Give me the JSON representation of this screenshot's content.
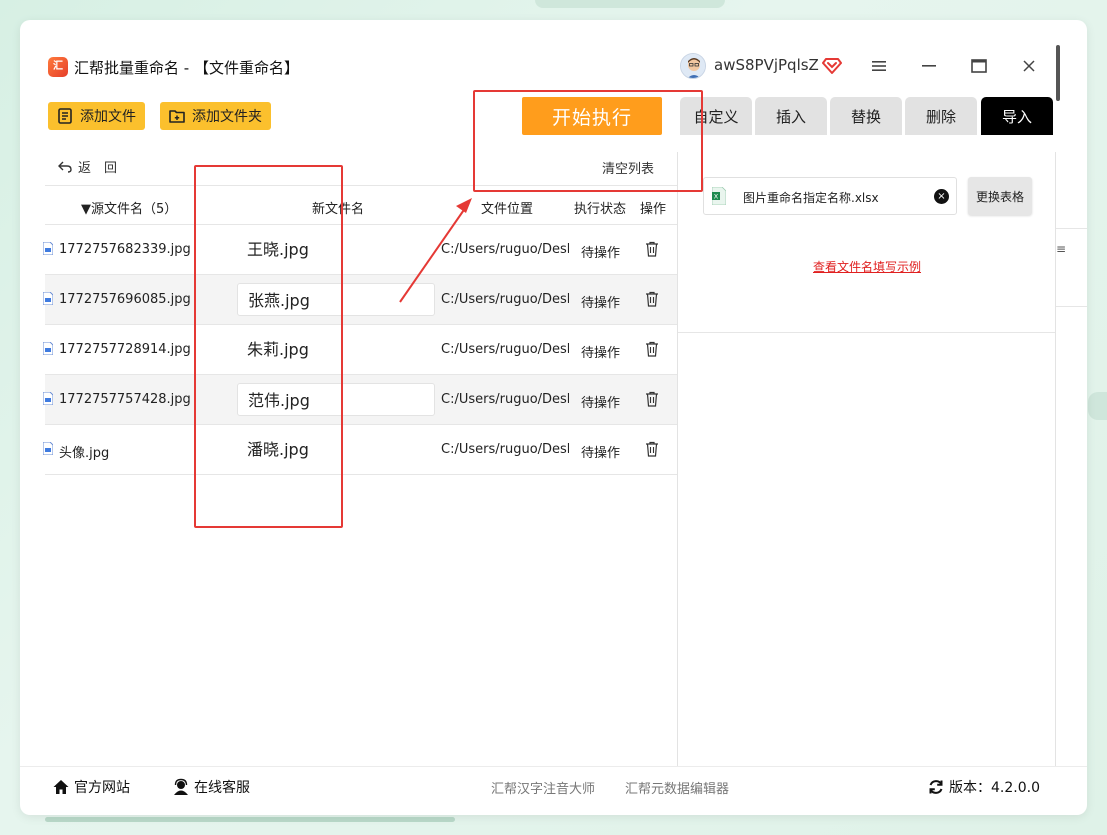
{
  "app": {
    "title": "汇帮批量重命名 - 【文件重命名】",
    "logo_text": "汇",
    "user_name": "awS8PVjPqlsZ"
  },
  "window_controls": {
    "menu": "≡",
    "minimize": "–",
    "maximize": "▭",
    "close": "×"
  },
  "toolbar": {
    "add_file": "添加文件",
    "add_folder": "添加文件夹",
    "start": "开始执行"
  },
  "tabs": [
    {
      "label": "自定义",
      "active": false
    },
    {
      "label": "插入",
      "active": false
    },
    {
      "label": "替换",
      "active": false
    },
    {
      "label": "删除",
      "active": false
    },
    {
      "label": "导入",
      "active": true
    }
  ],
  "list": {
    "back": "返　回",
    "clear": "清空列表",
    "headers": {
      "source": "源文件名（5）",
      "new_name": "新文件名",
      "location": "文件位置",
      "status": "执行状态",
      "action": "操作"
    },
    "rows": [
      {
        "source": "1772757682339.jpg",
        "new_name": "王晓.jpg",
        "location": "C:/Users/ruguo/Desktop",
        "status": "待操作"
      },
      {
        "source": "1772757696085.jpg",
        "new_name": "张燕.jpg",
        "location": "C:/Users/ruguo/Desktop",
        "status": "待操作"
      },
      {
        "source": "1772757728914.jpg",
        "new_name": "朱莉.jpg",
        "location": "C:/Users/ruguo/Desktop",
        "status": "待操作"
      },
      {
        "source": "1772757757428.jpg",
        "new_name": "范伟.jpg",
        "location": "C:/Users/ruguo/Desktop",
        "status": "待操作"
      },
      {
        "source": "头像.jpg",
        "new_name": "潘晓.jpg",
        "location": "C:/Users/ruguo/Desktop",
        "status": "待操作"
      }
    ]
  },
  "import_panel": {
    "file_name": "图片重命名指定名称.xlsx",
    "file_icon_letter": "X",
    "close": "×",
    "change_button": "更换表格",
    "example_link": "查看文件名填写示例",
    "edge_glyph": "≡"
  },
  "footer": {
    "website": "官方网站",
    "support": "在线客服",
    "product1": "汇帮汉字注音大师",
    "product2": "汇帮元数据编辑器",
    "version": "版本：4.2.0.0"
  },
  "colors": {
    "accent_yellow": "#fbc02d",
    "start_orange": "#ff9d1c",
    "annotation_red": "#e53935",
    "link_red": "#e02020",
    "excel_green": "#1d8a4f"
  }
}
